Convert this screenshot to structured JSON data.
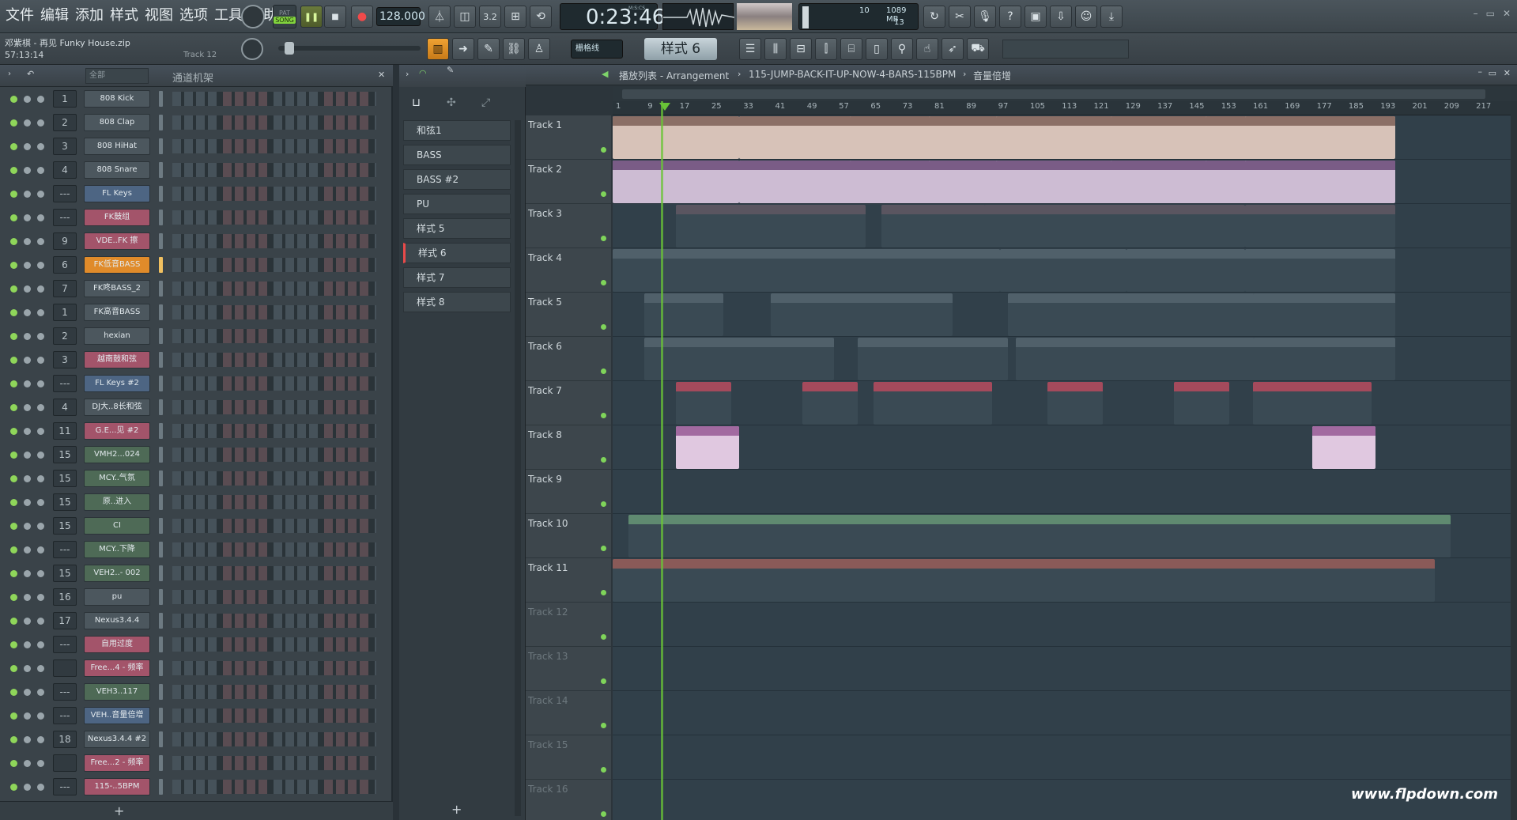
{
  "menu": [
    "文件",
    "编辑",
    "添加",
    "样式",
    "视图",
    "选项",
    "工具",
    "帮助"
  ],
  "transport": {
    "mode": "SONG",
    "tempo": "128.000",
    "time": "0:23:46",
    "time_sub": "M:S:CS",
    "cpu": "10",
    "memory": "1089 MB",
    "polyphony": "13"
  },
  "project": {
    "name": "邓紫棋 - 再见 Funky House.zip",
    "time": "57:13:14",
    "track_hint": "Track 12"
  },
  "toolbar2": {
    "snap": "栅格线",
    "pattern": "样式 6"
  },
  "channel_rack": {
    "filter": "全部",
    "title": "通道机架",
    "channels": [
      {
        "num": "1",
        "name": "808 Kick",
        "color": "#4c575e"
      },
      {
        "num": "2",
        "name": "808 Clap",
        "color": "#4c575e"
      },
      {
        "num": "3",
        "name": "808 HiHat",
        "color": "#4c575e"
      },
      {
        "num": "4",
        "name": "808 Snare",
        "color": "#4c575e"
      },
      {
        "num": "---",
        "name": "FL Keys",
        "color": "#4d6583"
      },
      {
        "num": "---",
        "name": "FK鼓组",
        "color": "#a3546a"
      },
      {
        "num": "9",
        "name": "VDE..FK 擦",
        "color": "#a3546a"
      },
      {
        "num": "6",
        "name": "FK低音BASS",
        "color": "#e08b2a"
      },
      {
        "num": "7",
        "name": "FK咚BASS_2",
        "color": "#4c575e"
      },
      {
        "num": "1",
        "name": "FK高音BASS",
        "color": "#4c575e"
      },
      {
        "num": "2",
        "name": "hexian",
        "color": "#4c575e"
      },
      {
        "num": "3",
        "name": "越南鼓和弦",
        "color": "#a3546a"
      },
      {
        "num": "---",
        "name": "FL Keys #2",
        "color": "#4d6583"
      },
      {
        "num": "4",
        "name": "DJ大..8长和弦",
        "color": "#4c575e"
      },
      {
        "num": "11",
        "name": "G.E...见 #2",
        "color": "#a3546a"
      },
      {
        "num": "15",
        "name": "VMH2...024",
        "color": "#4e6a56"
      },
      {
        "num": "15",
        "name": "MCY..气氛",
        "color": "#4e6a56"
      },
      {
        "num": "15",
        "name": "原..进入",
        "color": "#4e6a56"
      },
      {
        "num": "15",
        "name": "CI",
        "color": "#4e6a56"
      },
      {
        "num": "---",
        "name": "MCY..下降",
        "color": "#4e6a56"
      },
      {
        "num": "15",
        "name": "VEH2..- 002",
        "color": "#4e6a56"
      },
      {
        "num": "16",
        "name": "pu",
        "color": "#4c575e"
      },
      {
        "num": "17",
        "name": "Nexus3.4.4",
        "color": "#4c575e"
      },
      {
        "num": "---",
        "name": "自用过度",
        "color": "#a3546a"
      },
      {
        "num": "",
        "name": "Free...4 - 频率",
        "color": "#a3546a"
      },
      {
        "num": "---",
        "name": "VEH3..117",
        "color": "#4e6a56"
      },
      {
        "num": "---",
        "name": "VEH..音量倍增",
        "color": "#4d6583"
      },
      {
        "num": "18",
        "name": "Nexus3.4.4 #2",
        "color": "#4c575e"
      },
      {
        "num": "",
        "name": "Free...2 - 频率",
        "color": "#a3546a"
      },
      {
        "num": "---",
        "name": "115-..5BPM",
        "color": "#a3546a"
      }
    ]
  },
  "patterns": [
    "和弦1",
    "BASS",
    "BASS #2",
    "PU",
    "样式 5",
    "样式 6",
    "样式 7",
    "样式 8"
  ],
  "playlist": {
    "title": "播放列表 - Arrangement",
    "breadcrumb": "115-JUMP-BACK-IT-UP-NOW-4-BARS-115BPM",
    "breadcrumb2": "音量倍增",
    "ruler": [
      "1",
      "9",
      "17",
      "25",
      "33",
      "41",
      "49",
      "57",
      "65",
      "73",
      "81",
      "89",
      "97",
      "105",
      "113",
      "121",
      "129",
      "137",
      "145",
      "153",
      "161",
      "169",
      "177",
      "185",
      "193",
      "201",
      "209",
      "217"
    ],
    "tracks": [
      "Track 1",
      "Track 2",
      "Track 3",
      "Track 4",
      "Track 5",
      "Track 6",
      "Track 7",
      "Track 8",
      "Track 9",
      "Track 10",
      "Track 11",
      "Track 12",
      "Track 13",
      "Track 14",
      "Track 15",
      "Track 16"
    ]
  },
  "watermark": "www.flpdown.com",
  "colors": {
    "accent": "#e08b2a",
    "playhead": "#69c437"
  }
}
